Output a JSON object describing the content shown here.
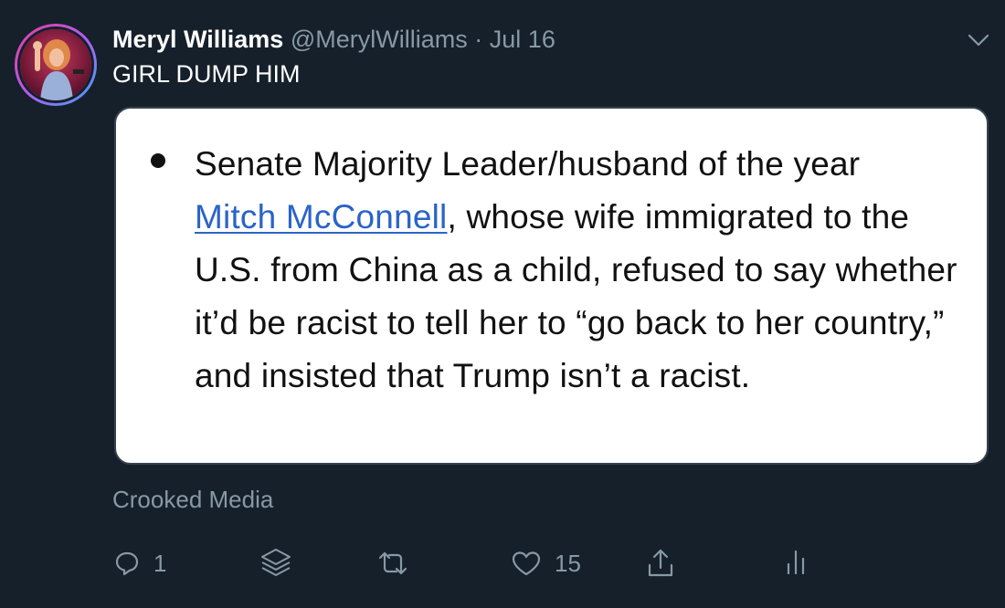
{
  "tweet": {
    "author_name": "Meryl Williams",
    "handle": "@MerylWilliams",
    "separator": "·",
    "date": "Jul 16",
    "text": "GIRL DUMP HIM",
    "source": "Crooked Media"
  },
  "card": {
    "bullet": "•",
    "line1": "Senate Majority Leader/husband of the year",
    "link": "Mitch McConnell",
    "rest": ", whose wife immigrated to the U.S. from China as a child, refused to say whether it’d be racist to tell her to “go back to her country,” and insisted that Trump isn’t a racist."
  },
  "actions": {
    "reply_count": "1",
    "like_count": "15"
  },
  "icons": {
    "caret": "chevron-down-icon",
    "reply": "reply-icon",
    "stack": "layers-icon",
    "retweet": "retweet-icon",
    "like": "heart-icon",
    "share": "share-icon",
    "analytics": "analytics-icon"
  },
  "colors": {
    "background": "#15202b",
    "secondary_text": "#8899a6",
    "link": "#2a64c8",
    "card_border": "#38444d"
  }
}
